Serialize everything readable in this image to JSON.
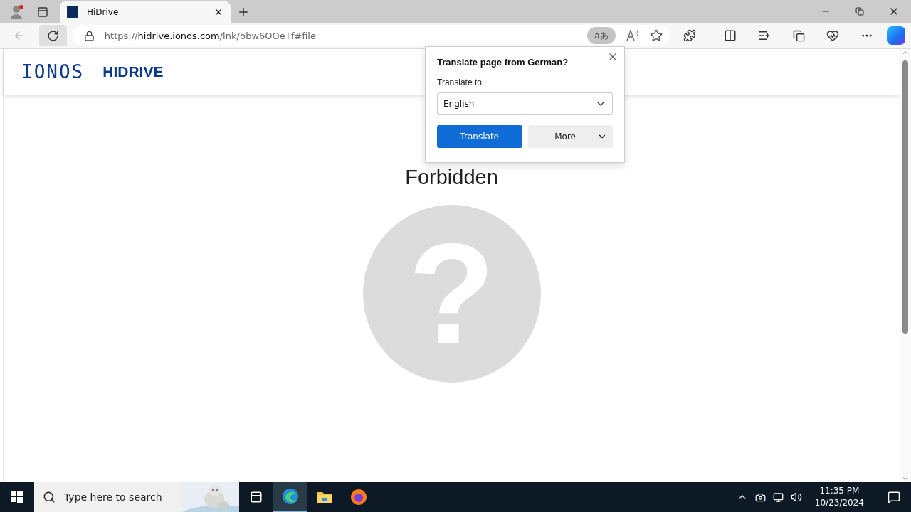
{
  "browser_tab": {
    "title": "HiDrive",
    "selected": true
  },
  "address_bar": {
    "scheme": "https://",
    "host": "hidrive.ionos.com",
    "path": "/lnk/bbw6OOeTf#file"
  },
  "translate_indicator": {
    "glyph": "aあ"
  },
  "header": {
    "logo": "IONOS",
    "product": "HIDRIVE"
  },
  "page": {
    "heading": "Forbidden",
    "glyph": "?"
  },
  "translate_popup": {
    "title": "Translate page from  German?",
    "label": "Translate to",
    "language": "English",
    "primary_button": "Translate",
    "secondary_button": "More"
  },
  "taskbar": {
    "search_placeholder": "Type here to search",
    "time": "11:35 PM",
    "date": "10/23/2024"
  }
}
